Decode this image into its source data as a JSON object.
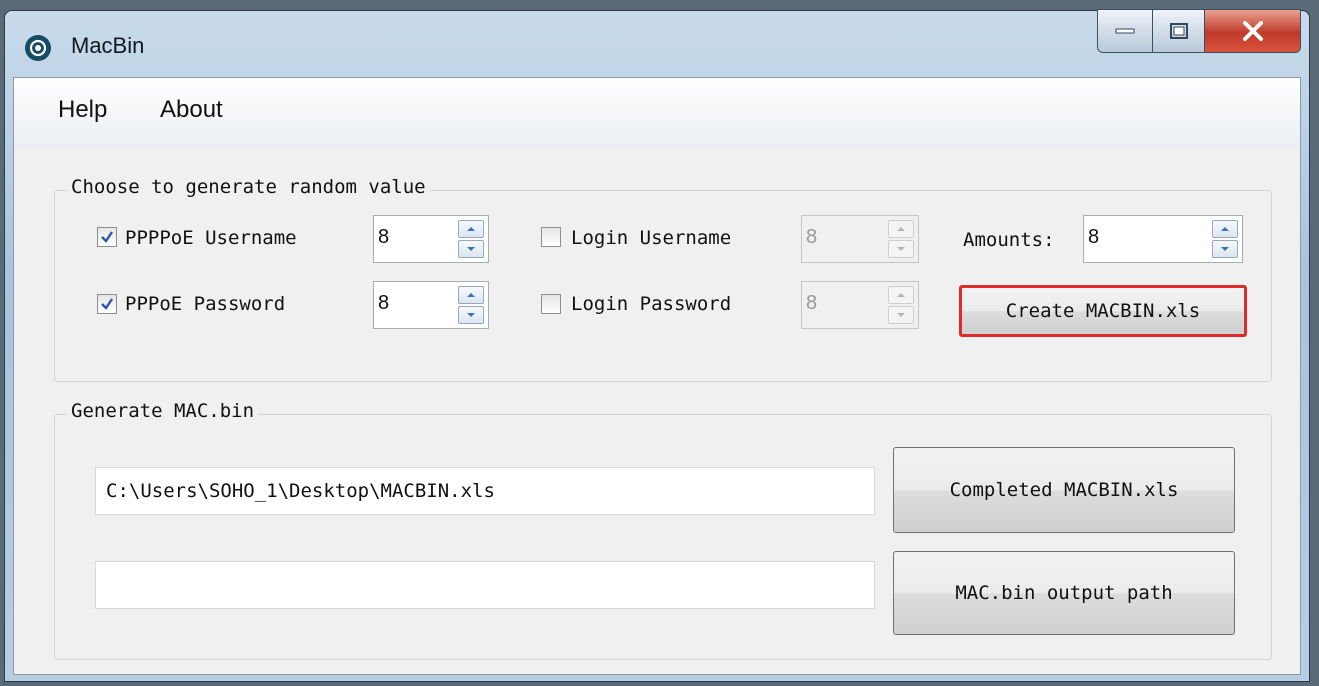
{
  "window": {
    "title": "MacBin",
    "icon": "macbin-app-icon"
  },
  "menu": {
    "items": [
      "Help",
      "About"
    ]
  },
  "random_group": {
    "title": "Choose to generate random value",
    "pppoe_username": {
      "label": "PPPPoE Username",
      "checked": true,
      "value": "8"
    },
    "pppoe_password": {
      "label": "PPPoE Password",
      "checked": true,
      "value": "8"
    },
    "login_username": {
      "label": "Login Username",
      "checked": false,
      "value": "8"
    },
    "login_password": {
      "label": "Login Password",
      "checked": false,
      "value": "8"
    },
    "amounts": {
      "label": "Amounts:",
      "value": "8"
    },
    "create_button": "Create MACBIN.xls"
  },
  "mac_group": {
    "title": "Generate MAC.bin",
    "xls_path": "C:\\Users\\SOHO_1\\Desktop\\MACBIN.xls",
    "output_path": "",
    "completed_button": "Completed MACBIN.xls",
    "output_button": "MAC.bin output path"
  },
  "colors": {
    "highlight": "#e02b2b",
    "close_button": "#c0392b"
  }
}
